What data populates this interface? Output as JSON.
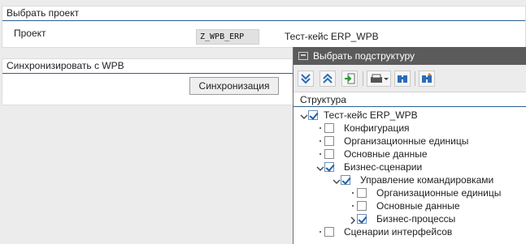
{
  "project_group": {
    "title": "Выбрать проект",
    "label": "Проект",
    "project_code": "Z_WPB_ERP",
    "project_desc": "Тест-кейс ERP_WPB"
  },
  "sync_group": {
    "title": "Синхронизировать с WPB",
    "button": "Синхронизация"
  },
  "popup": {
    "title": "Выбрать подструктуру",
    "window_icon": "window-icon",
    "toolbar_icons": [
      "expand-all-icon",
      "collapse-all-icon",
      "select-node-icon",
      "print-icon",
      "find-icon",
      "find-next-icon"
    ],
    "column_header": "Структура",
    "tree": [
      {
        "label": "Тест-кейс ERP_WPB",
        "checked": true,
        "expander": "open"
      },
      {
        "label": "Конфигурация",
        "checked": false,
        "expander": "leaf"
      },
      {
        "label": "Организационные единицы",
        "checked": false,
        "expander": "leaf"
      },
      {
        "label": "Основные данные",
        "checked": false,
        "expander": "leaf"
      },
      {
        "label": "Бизнес-сценарии",
        "checked": true,
        "expander": "open"
      },
      {
        "label": "Управление командировками",
        "checked": true,
        "expander": "open"
      },
      {
        "label": "Организационные единицы",
        "checked": false,
        "expander": "leaf"
      },
      {
        "label": "Основные данные",
        "checked": false,
        "expander": "leaf"
      },
      {
        "label": "Бизнес-процессы",
        "checked": true,
        "expander": "closed"
      },
      {
        "label": "Сценарии интерфейсов",
        "checked": false,
        "expander": "leaf"
      }
    ]
  }
}
